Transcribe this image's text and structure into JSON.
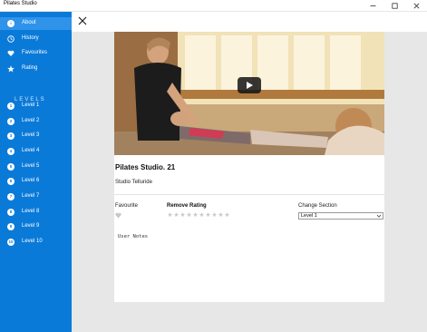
{
  "window": {
    "title": "Pilates Studio"
  },
  "sidebar": {
    "items": [
      {
        "label": "About",
        "icon": "info-icon"
      },
      {
        "label": "History",
        "icon": "clock-icon"
      },
      {
        "label": "Favourites",
        "icon": "heart-icon"
      },
      {
        "label": "Rating",
        "icon": "star-icon"
      }
    ],
    "levels_header": "LEVELS",
    "levels": [
      {
        "num": "1",
        "label": "Level 1"
      },
      {
        "num": "2",
        "label": "Level 2"
      },
      {
        "num": "3",
        "label": "Level 3"
      },
      {
        "num": "4",
        "label": "Level 4"
      },
      {
        "num": "5",
        "label": "Level 5"
      },
      {
        "num": "6",
        "label": "Level 6"
      },
      {
        "num": "7",
        "label": "Level 7"
      },
      {
        "num": "8",
        "label": "Level 8"
      },
      {
        "num": "9",
        "label": "Level 9"
      },
      {
        "num": "10",
        "label": "Level 10"
      }
    ]
  },
  "video": {
    "title": "Pilates Studio. 21",
    "studio": "Studio Telluride"
  },
  "details": {
    "favourite_label": "Favourite",
    "remove_rating_label": "Remove Rating",
    "rating_value": 0,
    "rating_max": 10,
    "change_section_label": "Change Section",
    "section_value": "Level 1"
  },
  "notes": {
    "placeholder": "User Notes"
  },
  "colors": {
    "sidebar": "#0a7ad9",
    "sidebar_active": "#2f93ea",
    "main_bg": "#e7e7e7"
  }
}
